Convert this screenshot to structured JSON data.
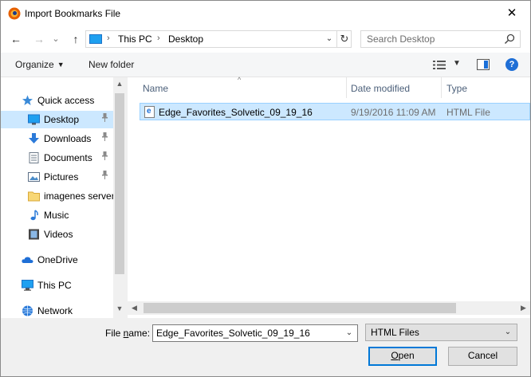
{
  "window": {
    "title": "Import Bookmarks File",
    "close_glyph": "✕",
    "accent_color": "#0078d7"
  },
  "nav": {
    "back_glyph": "←",
    "forward_glyph": "→",
    "recent_glyph": "⌄",
    "up_glyph": "↑",
    "address": {
      "crumbs": [
        "This PC",
        "Desktop"
      ],
      "separator": "›",
      "dropdown_glyph": "⌄",
      "refresh_glyph": "↻"
    },
    "search": {
      "placeholder": "Search Desktop"
    }
  },
  "toolbar": {
    "organize_label": "Organize",
    "caret": "▼",
    "new_folder_label": "New folder",
    "help_glyph": "?"
  },
  "sidebar": {
    "items": [
      {
        "label": "Quick access",
        "icon": "star-icon",
        "top": true,
        "selected": false,
        "pinned": false
      },
      {
        "label": "Desktop",
        "icon": "desktop-icon",
        "top": false,
        "selected": true,
        "pinned": true
      },
      {
        "label": "Downloads",
        "icon": "download-icon",
        "top": false,
        "selected": false,
        "pinned": true
      },
      {
        "label": "Documents",
        "icon": "documents-icon",
        "top": false,
        "selected": false,
        "pinned": true
      },
      {
        "label": "Pictures",
        "icon": "pictures-icon",
        "top": false,
        "selected": false,
        "pinned": true
      },
      {
        "label": "imagenes server",
        "icon": "folder-icon",
        "top": false,
        "selected": false,
        "pinned": false
      },
      {
        "label": "Music",
        "icon": "music-icon",
        "top": false,
        "selected": false,
        "pinned": false
      },
      {
        "label": "Videos",
        "icon": "videos-icon",
        "top": false,
        "selected": false,
        "pinned": false
      },
      {
        "label": "OneDrive",
        "icon": "cloud-icon",
        "top": true,
        "selected": false,
        "pinned": false
      },
      {
        "label": "This PC",
        "icon": "computer-icon",
        "top": true,
        "selected": false,
        "pinned": false
      },
      {
        "label": "Network",
        "icon": "network-icon",
        "top": true,
        "selected": false,
        "pinned": false
      }
    ],
    "pin_glyph": "📌"
  },
  "files": {
    "columns": [
      "Name",
      "Date modified",
      "Type"
    ],
    "sort_glyph": "^",
    "rows": [
      {
        "name": "Edge_Favorites_Solvetic_09_19_16",
        "date": "9/19/2016 11:09 AM",
        "type": "HTML File",
        "selected": true
      }
    ]
  },
  "footer": {
    "file_name_label_pre": "File ",
    "file_name_label_key": "n",
    "file_name_label_post": "ame:",
    "file_name_value": "Edge_Favorites_Solvetic_09_19_16",
    "file_type_value": "HTML Files",
    "open_key": "O",
    "open_rest": "pen",
    "cancel_label": "Cancel"
  }
}
